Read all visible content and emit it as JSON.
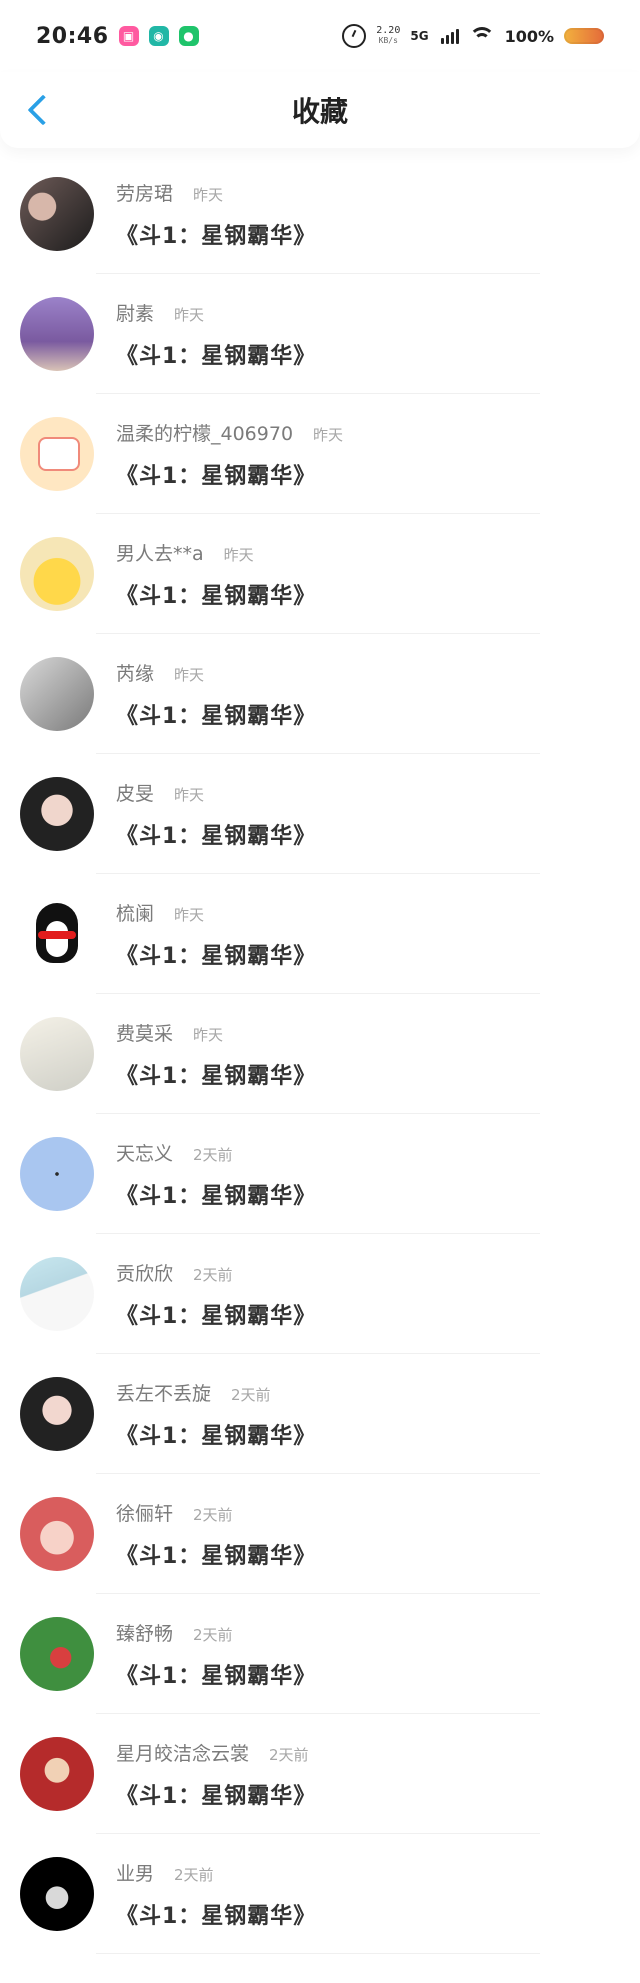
{
  "status_bar": {
    "time": "20:46",
    "net_speed": "2.20",
    "net_unit": "KB/s",
    "network": "5G",
    "battery": "100%",
    "icons": {
      "app1": "pink-app-icon",
      "app2": "teal-app-icon",
      "app3": "wechat-icon",
      "alarm": "alarm-clock-icon",
      "signal": "signal-bars-icon",
      "wifi": "wifi-icon",
      "battery": "battery-icon"
    }
  },
  "header": {
    "title": "收藏",
    "back_icon": "chevron-left-icon",
    "accent_color": "#2aa0e6"
  },
  "items": [
    {
      "name": "劳房珺",
      "time": "昨天",
      "title": "《斗1：星钢霸华》"
    },
    {
      "name": "尉素",
      "time": "昨天",
      "title": "《斗1：星钢霸华》"
    },
    {
      "name": "温柔的柠檬_406970",
      "time": "昨天",
      "title": "《斗1：星钢霸华》"
    },
    {
      "name": "男人去**a",
      "time": "昨天",
      "title": "《斗1：星钢霸华》"
    },
    {
      "name": "芮缘",
      "time": "昨天",
      "title": "《斗1：星钢霸华》"
    },
    {
      "name": "皮旻",
      "time": "昨天",
      "title": "《斗1：星钢霸华》"
    },
    {
      "name": "梳阑",
      "time": "昨天",
      "title": "《斗1：星钢霸华》"
    },
    {
      "name": "费莫采",
      "time": "昨天",
      "title": "《斗1：星钢霸华》"
    },
    {
      "name": "天忘义",
      "time": "2天前",
      "title": "《斗1：星钢霸华》"
    },
    {
      "name": "贡欣欣",
      "time": "2天前",
      "title": "《斗1：星钢霸华》"
    },
    {
      "name": "丢左不丢旋",
      "time": "2天前",
      "title": "《斗1：星钢霸华》"
    },
    {
      "name": "徐俪轩",
      "time": "2天前",
      "title": "《斗1：星钢霸华》"
    },
    {
      "name": "臻舒畅",
      "time": "2天前",
      "title": "《斗1：星钢霸华》"
    },
    {
      "name": "星月皎洁念云裳",
      "time": "2天前",
      "title": "《斗1：星钢霸华》"
    },
    {
      "name": "业男",
      "time": "2天前",
      "title": "《斗1：星钢霸华》"
    }
  ]
}
